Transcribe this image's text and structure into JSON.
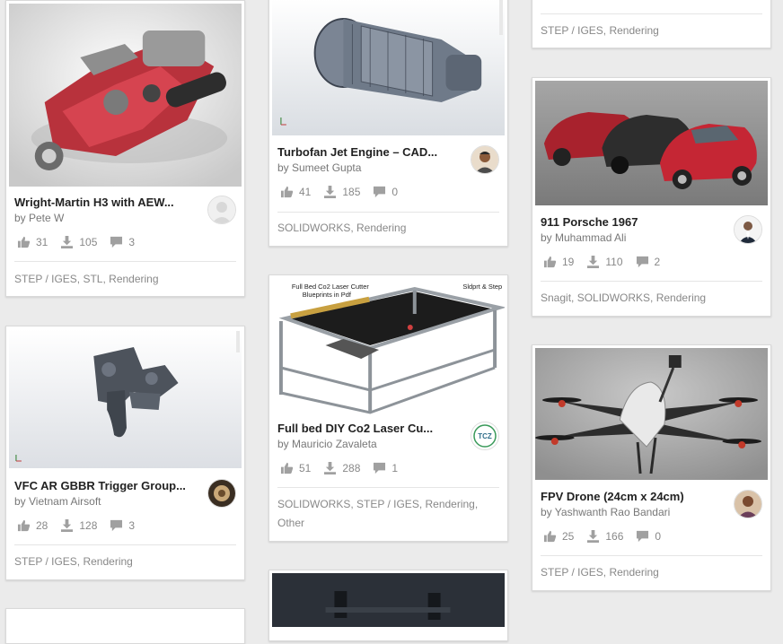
{
  "cards": {
    "wright_martin": {
      "title": "Wright-Martin H3 with AEW...",
      "author": "by Pete W",
      "likes": "31",
      "downloads": "105",
      "comments": "3",
      "tags": "STEP / IGES, STL, Rendering"
    },
    "turbofan": {
      "title": "Turbofan Jet Engine – CAD...",
      "author": "by Sumeet Gupta",
      "likes": "41",
      "downloads": "185",
      "comments": "0",
      "tags": "SOLIDWORKS, Rendering"
    },
    "top_right": {
      "tags": "STEP / IGES, Rendering"
    },
    "porsche": {
      "title": "911 Porsche 1967",
      "author": "by Muhammad Ali",
      "likes": "19",
      "downloads": "110",
      "comments": "2",
      "tags": "Snagit, SOLIDWORKS, Rendering"
    },
    "vfc_trigger": {
      "title": "VFC AR GBBR Trigger Group...",
      "author": "by Vietnam Airsoft",
      "likes": "28",
      "downloads": "128",
      "comments": "3",
      "tags": "STEP / IGES, Rendering"
    },
    "laser_cutter": {
      "title": "Full bed DIY Co2 Laser Cu...",
      "author": "by Mauricio Zavaleta",
      "likes": "51",
      "downloads": "288",
      "comments": "1",
      "tags_line1": "SOLIDWORKS, STEP / IGES, Rendering,",
      "tags_line2": "Other",
      "thumb_caption_left": "Full Bed Co2 Laser Cutter",
      "thumb_caption_left2": "Blueprints in Pdf",
      "thumb_caption_right": "Sldprt & Step",
      "avatar_text": "TCZ"
    },
    "fpv_drone": {
      "title": "FPV Drone (24cm x 24cm)",
      "author": "by Yashwanth Rao Bandari",
      "likes": "25",
      "downloads": "166",
      "comments": "0",
      "tags": "STEP / IGES, Rendering"
    }
  },
  "icons": {
    "like": "thumbs-up-icon",
    "download": "download-icon",
    "comment": "comment-icon"
  },
  "colors": {
    "background": "#ebebeb",
    "card": "#ffffff",
    "icon": "#9a9a9a",
    "title": "#222222",
    "meta": "#777777"
  }
}
